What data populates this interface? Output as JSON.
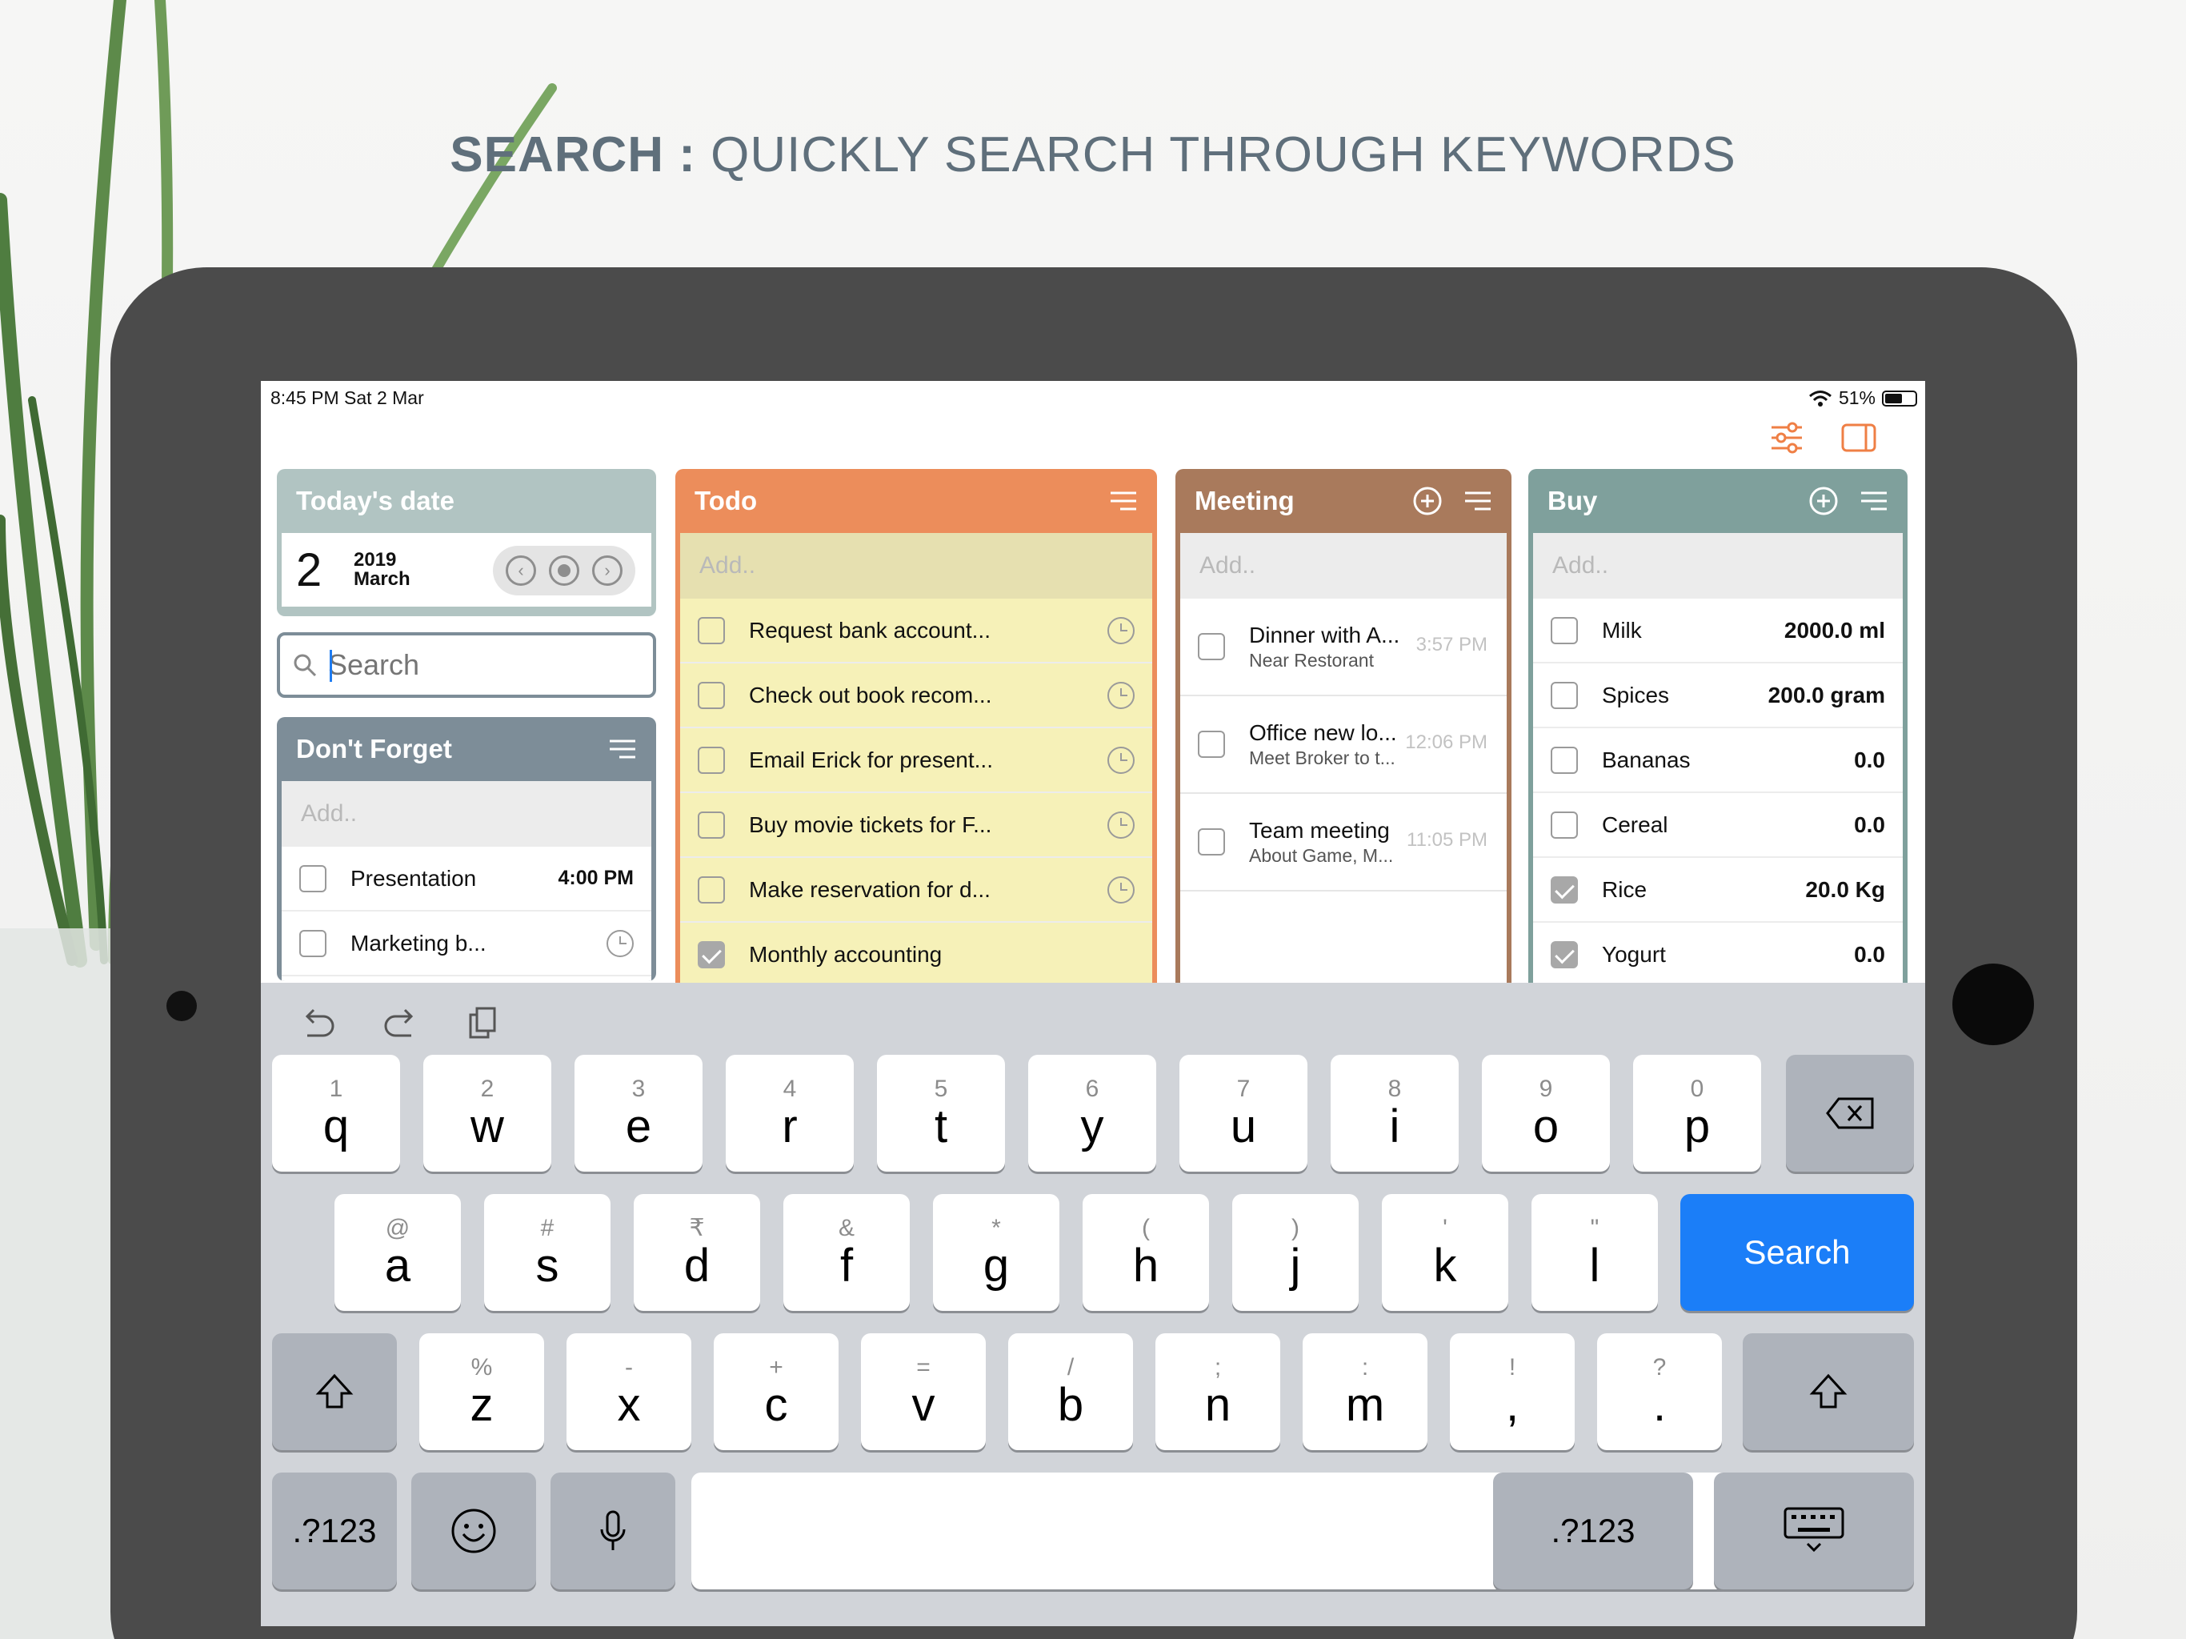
{
  "banner": {
    "bold": "SEARCH :",
    "rest": " QUICKLY SEARCH THROUGH KEYWORDS"
  },
  "status": {
    "time": "8:45 PM   Sat 2 Mar",
    "battery": "51%",
    "battery_level": 0.51
  },
  "today": {
    "header": "Today's date",
    "day": "2",
    "year": "2019",
    "month": "March"
  },
  "search": {
    "placeholder": "Search"
  },
  "dont_forget": {
    "header": "Don't Forget",
    "add": "Add..",
    "items": [
      {
        "text": "Presentation",
        "time": "4:00 PM",
        "checked": false
      },
      {
        "text": "Marketing b...",
        "checked": false
      }
    ]
  },
  "todo": {
    "header": "Todo",
    "add": "Add..",
    "items": [
      {
        "text": "Request bank account...",
        "checked": false
      },
      {
        "text": "Check out book recom...",
        "checked": false
      },
      {
        "text": "Email Erick for present...",
        "checked": false
      },
      {
        "text": "Buy movie tickets for F...",
        "checked": false
      },
      {
        "text": "Make reservation for d...",
        "checked": false
      },
      {
        "text": "Monthly accounting",
        "checked": true
      }
    ]
  },
  "meeting": {
    "header": "Meeting",
    "add": "Add..",
    "items": [
      {
        "title": "Dinner with A...",
        "sub": "Near Restorant",
        "time": "3:57 PM"
      },
      {
        "title": "Office new lo...",
        "sub": "Meet Broker to t...",
        "time": "12:06 PM"
      },
      {
        "title": "Team meeting",
        "sub": "About Game, M...",
        "time": "11:05 PM"
      }
    ]
  },
  "buy": {
    "header": "Buy",
    "add": "Add..",
    "items": [
      {
        "text": "Milk",
        "value": "2000.0 ml",
        "checked": false
      },
      {
        "text": "Spices",
        "value": "200.0 gram",
        "checked": false
      },
      {
        "text": "Bananas",
        "value": "0.0",
        "checked": false
      },
      {
        "text": "Cereal",
        "value": "0.0",
        "checked": false
      },
      {
        "text": "Rice",
        "value": "20.0 Kg",
        "checked": true
      },
      {
        "text": "Yogurt",
        "value": "0.0",
        "checked": true
      }
    ]
  },
  "keyboard": {
    "row1": [
      [
        "1",
        "q"
      ],
      [
        "2",
        "w"
      ],
      [
        "3",
        "e"
      ],
      [
        "4",
        "r"
      ],
      [
        "5",
        "t"
      ],
      [
        "6",
        "y"
      ],
      [
        "7",
        "u"
      ],
      [
        "8",
        "i"
      ],
      [
        "9",
        "o"
      ],
      [
        "0",
        "p"
      ]
    ],
    "row2": [
      [
        "@",
        "a"
      ],
      [
        "#",
        "s"
      ],
      [
        "₹",
        "d"
      ],
      [
        "&",
        "f"
      ],
      [
        "*",
        "g"
      ],
      [
        "(",
        "h"
      ],
      [
        ")",
        "j"
      ],
      [
        "'",
        "k"
      ],
      [
        "\"",
        "l"
      ]
    ],
    "row3": [
      [
        "%",
        "z"
      ],
      [
        "-",
        "x"
      ],
      [
        "+",
        "c"
      ],
      [
        "=",
        "v"
      ],
      [
        "/",
        "b"
      ],
      [
        ";",
        "n"
      ],
      [
        ":",
        "m"
      ],
      [
        "!",
        ","
      ],
      [
        "?",
        "."
      ]
    ],
    "search_label": "Search",
    "numbers_label": ".?123"
  },
  "colors": {
    "today": "#b1c4c2",
    "todo": "#ec8d5b",
    "todo_body": "#f6f1b8",
    "meeting": "#a97a5c",
    "buy": "#7fa09c",
    "dont_forget": "#7d8d98",
    "accent": "#ef7f45",
    "key_blue": "#1b7ef8"
  }
}
